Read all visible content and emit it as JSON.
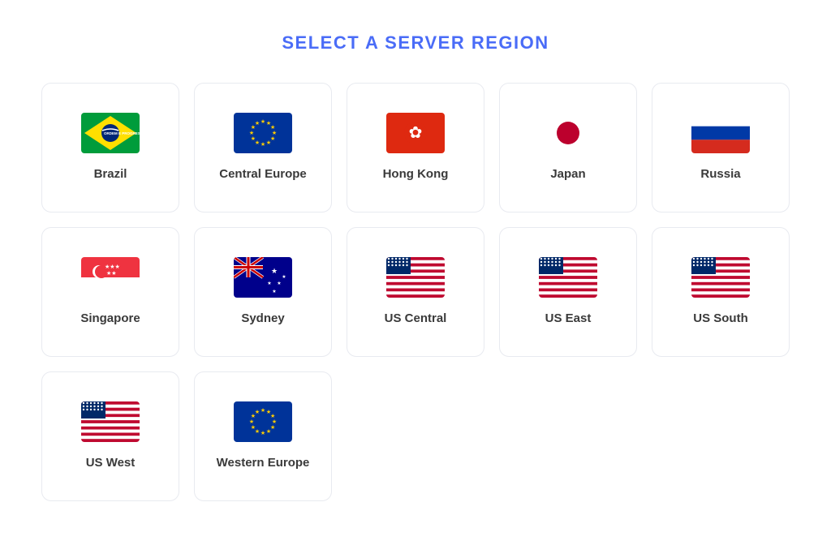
{
  "page": {
    "title": "SELECT A SERVER REGION"
  },
  "regions": [
    {
      "id": "brazil",
      "label": "Brazil",
      "flag": "brazil"
    },
    {
      "id": "central-europe",
      "label": "Central Europe",
      "flag": "eu"
    },
    {
      "id": "hong-kong",
      "label": "Hong Kong",
      "flag": "hk"
    },
    {
      "id": "japan",
      "label": "Japan",
      "flag": "japan"
    },
    {
      "id": "russia",
      "label": "Russia",
      "flag": "russia"
    },
    {
      "id": "singapore",
      "label": "Singapore",
      "flag": "singapore"
    },
    {
      "id": "sydney",
      "label": "Sydney",
      "flag": "australia"
    },
    {
      "id": "us-central",
      "label": "US Central",
      "flag": "us"
    },
    {
      "id": "us-east",
      "label": "US East",
      "flag": "us"
    },
    {
      "id": "us-south",
      "label": "US South",
      "flag": "us"
    },
    {
      "id": "us-west",
      "label": "US West",
      "flag": "us"
    },
    {
      "id": "western-europe",
      "label": "Western Europe",
      "flag": "eu"
    }
  ]
}
